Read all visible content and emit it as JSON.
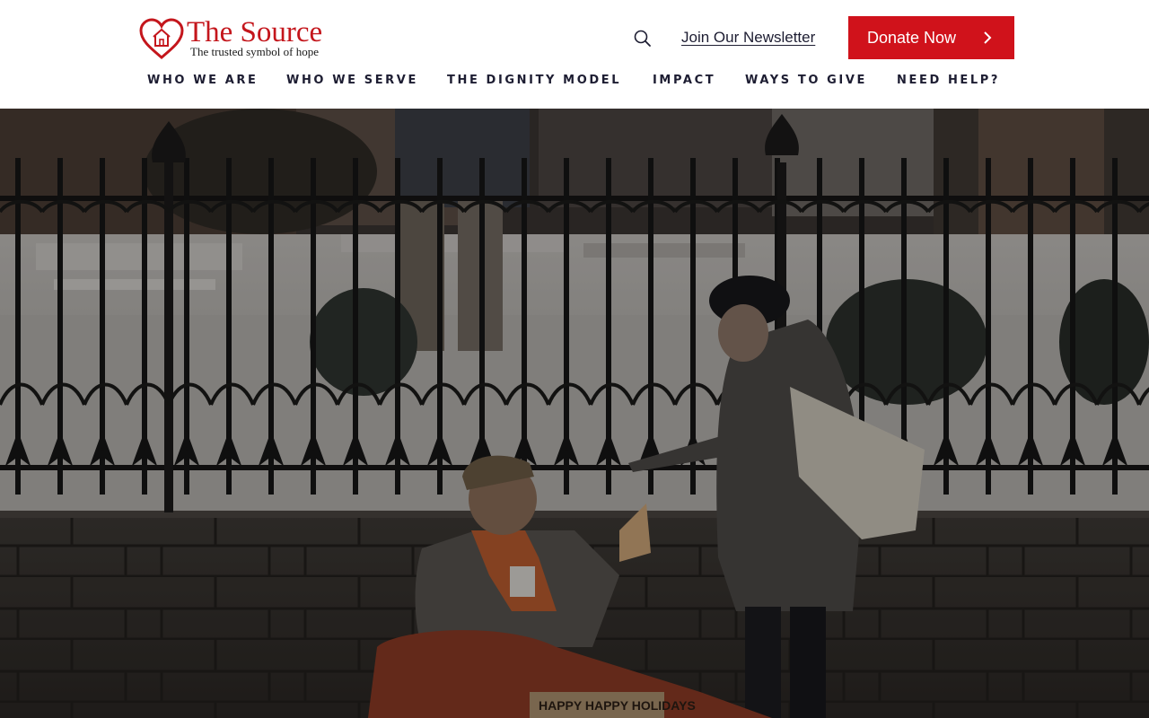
{
  "brand": {
    "name": "The Source",
    "tagline": "The trusted symbol of hope",
    "logo_icon": "heart-house-icon",
    "color": "#c4161c"
  },
  "header": {
    "search_icon": "search-icon",
    "newsletter_label": "Join Our Newsletter",
    "donate_label": "Donate Now",
    "donate_icon": "chevron-right-icon",
    "donate_color": "#d0121b"
  },
  "nav": {
    "items": [
      {
        "label": "WHO WE ARE"
      },
      {
        "label": "WHO WE SERVE"
      },
      {
        "label": "THE DIGNITY MODEL"
      },
      {
        "label": "IMPACT"
      },
      {
        "label": "WAYS TO GIVE"
      },
      {
        "label": "NEED HELP?"
      }
    ],
    "color": "#1d1d32"
  },
  "hero": {
    "sign_text": "HAPPY HAPPY HOLIDAYS"
  }
}
